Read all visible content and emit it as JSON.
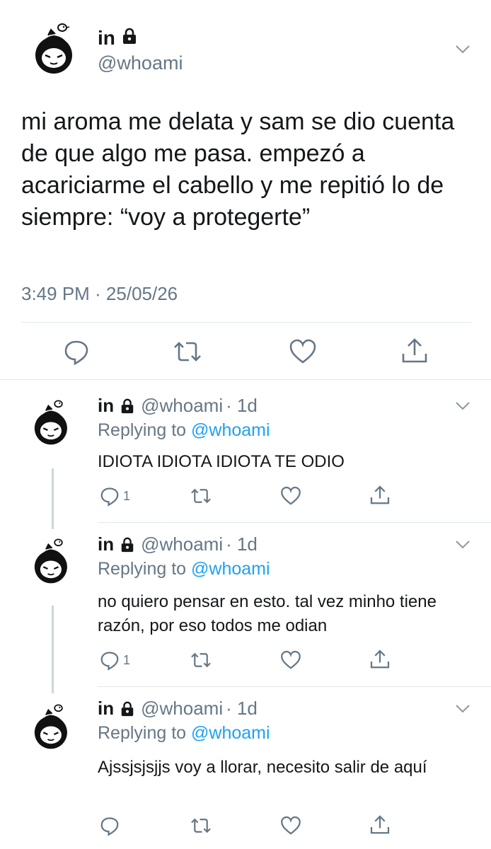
{
  "main_tweet": {
    "display_name": "in",
    "handle": "@whoami",
    "text": "mi aroma me delata y sam se dio cuenta de que algo me pasa. empezó a acariciarme el cabello y me repitió lo de siempre: “voy a protegerte”",
    "timestamp": "3:49 PM · 25/05/26",
    "actions": [
      "reply-icon",
      "retweet-icon",
      "like-icon",
      "share-icon"
    ]
  },
  "replies": [
    {
      "display_name": "in",
      "handle": "@whoami",
      "time": "· 1d",
      "replying_prefix": "Replying to ",
      "replying_to": "@whoami",
      "text": "IDIOTA IDIOTA IDIOTA TE ODIO",
      "reply_count": "1"
    },
    {
      "display_name": "in",
      "handle": "@whoami",
      "time": "· 1d",
      "replying_prefix": "Replying to ",
      "replying_to": "@whoami",
      "text": "no quiero pensar en esto. tal vez minho tiene razón, por eso todos me odian",
      "reply_count": "1"
    },
    {
      "display_name": "in",
      "handle": "@whoami",
      "time": "· 1d",
      "replying_prefix": "Replying to ",
      "replying_to": "@whoami",
      "text": "Ajssjsjsjjs voy a llorar, necesito salir de aquí",
      "reply_count": ""
    }
  ],
  "colors": {
    "text": "#14171a",
    "secondary": "#657786",
    "link": "#1da1f2",
    "divider": "#e1e8ed"
  }
}
